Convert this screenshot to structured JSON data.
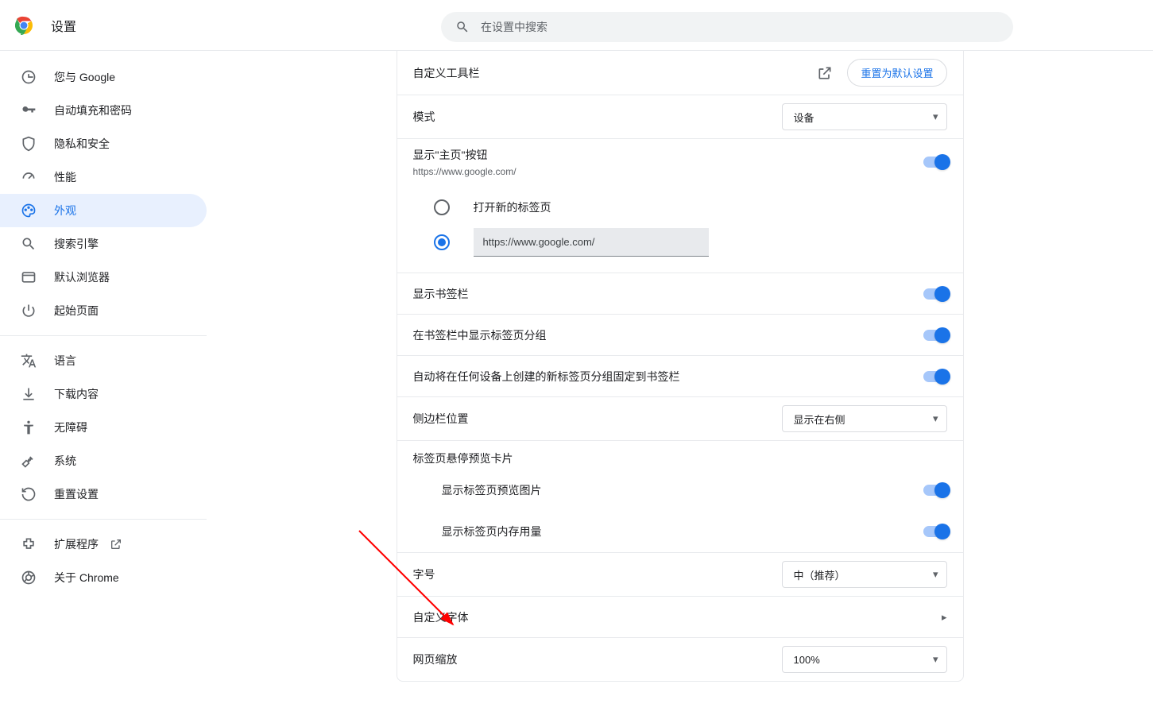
{
  "header": {
    "title": "设置",
    "search_placeholder": "在设置中搜索"
  },
  "sidebar": {
    "items": [
      {
        "label": "您与 Google",
        "icon": "google"
      },
      {
        "label": "自动填充和密码",
        "icon": "key"
      },
      {
        "label": "隐私和安全",
        "icon": "shield"
      },
      {
        "label": "性能",
        "icon": "speed"
      },
      {
        "label": "外观",
        "icon": "palette",
        "active": true
      },
      {
        "label": "搜索引擎",
        "icon": "search"
      },
      {
        "label": "默认浏览器",
        "icon": "window"
      },
      {
        "label": "起始页面",
        "icon": "power"
      }
    ],
    "items2": [
      {
        "label": "语言",
        "icon": "translate"
      },
      {
        "label": "下载内容",
        "icon": "download"
      },
      {
        "label": "无障碍",
        "icon": "accessibility"
      },
      {
        "label": "系统",
        "icon": "wrench"
      },
      {
        "label": "重置设置",
        "icon": "restore"
      }
    ],
    "items3": [
      {
        "label": "扩展程序",
        "icon": "extension",
        "external": true
      },
      {
        "label": "关于 Chrome",
        "icon": "chrome"
      }
    ]
  },
  "content": {
    "customize_toolbar": "自定义工具栏",
    "reset_default": "重置为默认设置",
    "mode_label": "模式",
    "mode_value": "设备",
    "home_button_label": "显示\"主页\"按钮",
    "home_button_sub": "https://www.google.com/",
    "radio_newtab": "打开新的标签页",
    "radio_url_value": "https://www.google.com/",
    "bookmarks_bar": "显示书签栏",
    "tab_groups_bookmark": "在书签栏中显示标签页分组",
    "pin_tab_groups": "自动将在任何设备上创建的新标签页分组固定到书签栏",
    "side_panel_label": "侧边栏位置",
    "side_panel_value": "显示在右侧",
    "hover_cards": "标签页悬停预览卡片",
    "hover_images": "显示标签页预览图片",
    "hover_memory": "显示标签页内存用量",
    "font_size_label": "字号",
    "font_size_value": "中（推荐）",
    "custom_fonts": "自定义字体",
    "page_zoom_label": "网页缩放",
    "page_zoom_value": "100%"
  }
}
